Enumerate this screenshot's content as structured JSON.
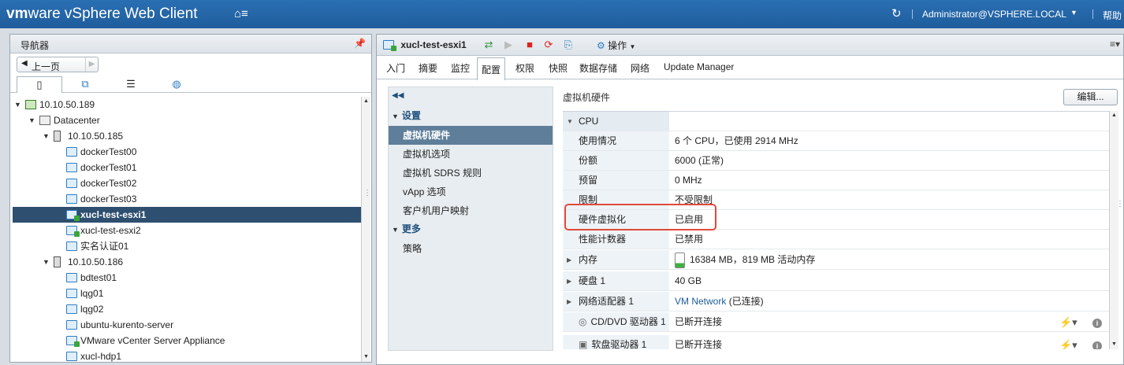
{
  "topbar": {
    "brand_a": "vm",
    "brand_b": "ware",
    "brand_c": " vSphere Web Client",
    "user": "Administrator@VSPHERE.LOCAL",
    "help": "帮助"
  },
  "navigator": {
    "title": "导航器",
    "back_label": "上一页",
    "tree": [
      {
        "label": "10.10.50.189",
        "level": 0,
        "kind": "vc",
        "expanded": true
      },
      {
        "label": "Datacenter",
        "level": 1,
        "kind": "dc",
        "expanded": true
      },
      {
        "label": "10.10.50.185",
        "level": 2,
        "kind": "host",
        "expanded": true
      },
      {
        "label": "dockerTest00",
        "level": 3,
        "kind": "vm"
      },
      {
        "label": "dockerTest01",
        "level": 3,
        "kind": "vm"
      },
      {
        "label": "dockerTest02",
        "level": 3,
        "kind": "vm"
      },
      {
        "label": "dockerTest03",
        "level": 3,
        "kind": "vm"
      },
      {
        "label": "xucl-test-esxi1",
        "level": 3,
        "kind": "vm-on",
        "selected": true
      },
      {
        "label": "xucl-test-esxi2",
        "level": 3,
        "kind": "vm-on"
      },
      {
        "label": "实名认证01",
        "level": 3,
        "kind": "vm"
      },
      {
        "label": "10.10.50.186",
        "level": 2,
        "kind": "host",
        "expanded": true
      },
      {
        "label": "bdtest01",
        "level": 3,
        "kind": "vm"
      },
      {
        "label": "lqg01",
        "level": 3,
        "kind": "vm"
      },
      {
        "label": "lqg02",
        "level": 3,
        "kind": "vm"
      },
      {
        "label": "ubuntu-kurento-server",
        "level": 3,
        "kind": "vm"
      },
      {
        "label": "VMware vCenter Server Appliance",
        "level": 3,
        "kind": "vm-on"
      },
      {
        "label": "xucl-hdp1",
        "level": 3,
        "kind": "vm"
      }
    ]
  },
  "main": {
    "object_title": "xucl-test-esxi1",
    "actions_label": "操作",
    "tabs": [
      "入门",
      "摘要",
      "监控",
      "配置",
      "权限",
      "快照",
      "数据存储",
      "网络",
      "Update Manager"
    ],
    "active_tab": "配置",
    "side_nav": {
      "group_settings": "设置",
      "items": [
        "虚拟机硬件",
        "虚拟机选项",
        "虚拟机 SDRS 规则",
        "vApp 选项",
        "客户机用户映射"
      ],
      "group_more": "更多",
      "more_items": [
        "策略"
      ]
    },
    "section_title": "虚拟机硬件",
    "edit_label": "编辑...",
    "rows": [
      {
        "name": "CPU",
        "value": "",
        "header": true,
        "expanded": true
      },
      {
        "name": "使用情况",
        "value": "6 个 CPU，已使用 2914 MHz"
      },
      {
        "name": "份额",
        "value": "6000 (正常)"
      },
      {
        "name": "预留",
        "value": "0 MHz"
      },
      {
        "name": "限制",
        "value": "不受限制"
      },
      {
        "name": "硬件虚拟化",
        "value": "已启用",
        "highlighted": true
      },
      {
        "name": "性能计数器",
        "value": "已禁用"
      },
      {
        "name": "内存",
        "value": "16384 MB，819 MB 活动内存",
        "collapsed": true
      },
      {
        "name": "硬盘 1",
        "value": "40 GB",
        "collapsed": true
      },
      {
        "name": "网络适配器 1",
        "value_link": "VM Network",
        "value": "(已连接)",
        "collapsed": true
      },
      {
        "name": "CD/DVD 驱动器 1",
        "value": "已断开连接"
      },
      {
        "name": "软盘驱动器 1",
        "value": "已断开连接"
      }
    ]
  }
}
